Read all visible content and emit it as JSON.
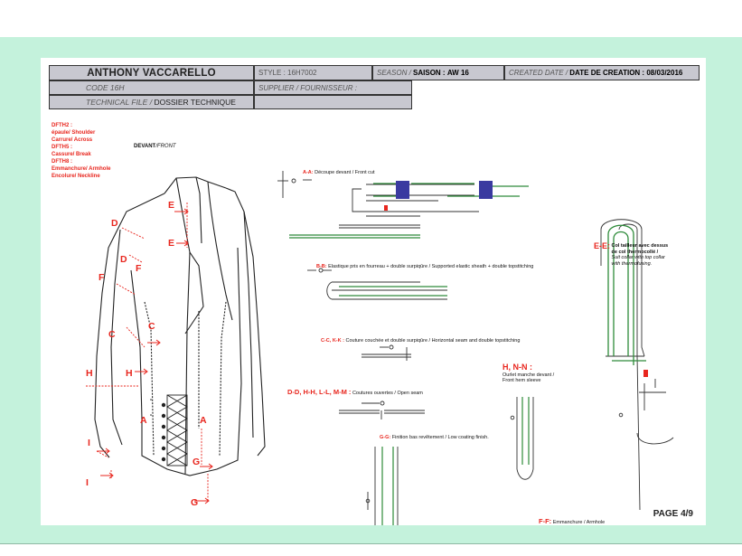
{
  "header": {
    "brand": "ANTHONY VACCARELLO",
    "code": "CODE 16H",
    "technical_file_prefix": "TECHNICAL FILE /",
    "technical_file": "DOSSIER TECHNIQUE",
    "style_label": "STYLE : 16H7002",
    "season_prefix": "SEASON /",
    "season_label": "SAISON :",
    "season_value": "AW 16",
    "created_prefix": "CREATED DATE /",
    "created_label": "DATE DE CREATION : 08/03/2016",
    "supplier_label": "SUPPLIER / FOURNISSEUR :"
  },
  "legend": {
    "line1": "DFTH2 :",
    "line2": "épaule/ Shoulder",
    "line3": "Carrure/ Across",
    "line4": "DFTH5 :",
    "line5": "Cassure/ Break",
    "line6": "DFTH8 :",
    "line7": "Emmanchure/ Armhole",
    "line8": "Encolure/ Neckline"
  },
  "front_view": {
    "label": "DEVANT",
    "label_en": "/FRONT"
  },
  "jacket_marks": [
    "E",
    "E",
    "D",
    "D",
    "F",
    "F",
    "C",
    "C",
    "H",
    "H",
    "A",
    "A",
    "I",
    "I",
    "G",
    "G"
  ],
  "details": {
    "aa_code": "A-A:",
    "aa_text": "Découpe devant / Front cut",
    "bb_code": "B-B:",
    "bb_text": "Elastique pris en fourreau + double surpiqûre / Supported elastic sheath + double topstitching",
    "cc_code": "C-C, K-K :",
    "cc_text": "Couture couchée et double surpiqûre / Horizontal seam and double topstitching",
    "dd_code": "D-D, H-H, L-L, M-M :",
    "dd_text": "Coutures ouvertes / Open seam",
    "ee_code": "E-E:",
    "ee_text1": "Col tailleur avec dessus",
    "ee_text2": "de col thermocollé /",
    "ee_text3": "Suit collar with top collar",
    "ee_text4": "with thermofusing.",
    "hn_code": "H, N-N :",
    "hn_text1": "Ourlet manche devant /",
    "hn_text2": "Front hem sleeve",
    "gg_code": "G-G:",
    "gg_text": "Finition bas revêtement / Low coating finish.",
    "ff_code": "F-F:",
    "ff_text": "Emmanchure / Armhole"
  },
  "page": "PAGE 4/9",
  "colors": {
    "stage": "#c4f2dc",
    "header_fill": "#c8c8d0",
    "accent_red": "#e8261e",
    "stitch_green": "#2e8b3a",
    "marker_blue": "#3a3aa0"
  }
}
